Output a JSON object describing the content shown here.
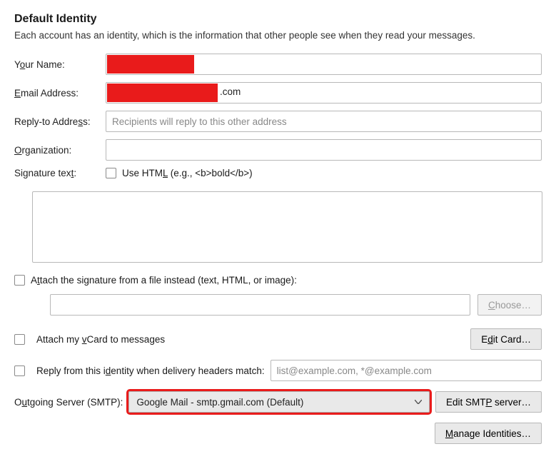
{
  "heading": "Default Identity",
  "description": "Each account has an identity, which is the information that other people see when they read your messages.",
  "labels": {
    "yourName_pre": "Y",
    "yourName_u": "o",
    "yourName_post": "ur Name:",
    "email_u": "E",
    "email_post": "mail Address:",
    "reply_pre": "Reply-to Addre",
    "reply_u": "s",
    "reply_post": "s:",
    "org_u": "O",
    "org_post": "rganization:",
    "sig_pre": "Signature tex",
    "sig_u": "t",
    "sig_post": ":"
  },
  "emailSuffix": ".com",
  "replyPlaceholder": "Recipients will reply to this other address",
  "useHtml_pre": "Use HTM",
  "useHtml_u": "L",
  "useHtml_post": " (e.g., <b>bold</b>)",
  "attachFile_pre": "A",
  "attachFile_u": "t",
  "attachFile_post": "tach the signature from a file instead (text, HTML, or image):",
  "choose_u": "C",
  "choose_post": "hoose…",
  "attachVcard_pre": "Attach my ",
  "attachVcard_u": "v",
  "attachVcard_post": "Card to messages",
  "editCard_pre": "E",
  "editCard_u": "d",
  "editCard_post": "it Card…",
  "replyHeaders_pre": "Reply from this i",
  "replyHeaders_u": "d",
  "replyHeaders_post": "entity when delivery headers match:",
  "replyHeadersPlaceholder": "list@example.com, *@example.com",
  "smtp_pre": "O",
  "smtp_u": "u",
  "smtp_post": "tgoing Server (SMTP):",
  "smtpValue": "Google Mail - smtp.gmail.com (Default)",
  "editSmtp_pre": "Edit SMT",
  "editSmtp_u": "P",
  "editSmtp_post": " server…",
  "manage_u": "M",
  "manage_post": "anage Identities…"
}
